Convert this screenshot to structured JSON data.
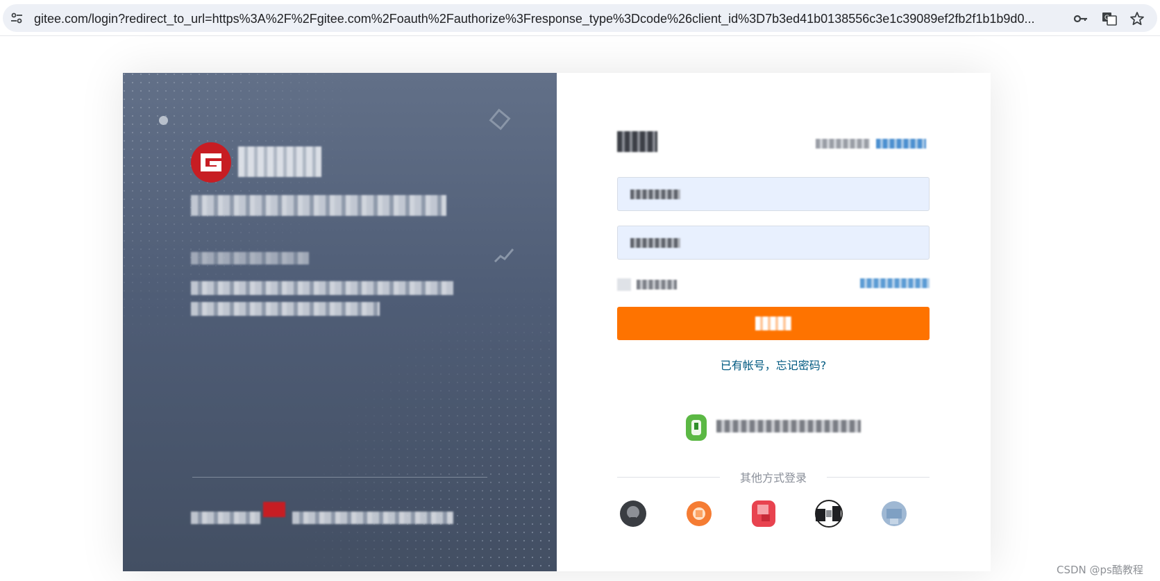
{
  "browser": {
    "url": "gitee.com/login?redirect_to_url=https%3A%2F%2Fgitee.com%2Foauth%2Fauthorize%3Fresponse_type%3Dcode%26client_id%3D7b3ed41b0138556c3e1c39089ef2fb2f1b1b9d0...",
    "icons": [
      "site-info-icon",
      "key-icon",
      "translate-icon",
      "star-icon"
    ]
  },
  "login": {
    "account_link": "已有帐号，忘记密码?",
    "other_methods": "其他方式登录",
    "social_icons": [
      "github-icon",
      "gitlab-icon",
      "huawei-icon",
      "panda-icon",
      "cloud-icon"
    ]
  },
  "colors": {
    "accent": "#fe7300",
    "link": "#005980",
    "panel_top": "#627088",
    "panel_bottom": "#434f63",
    "input_bg": "#e8f0fe"
  },
  "watermark": "CSDN @ps酷教程"
}
